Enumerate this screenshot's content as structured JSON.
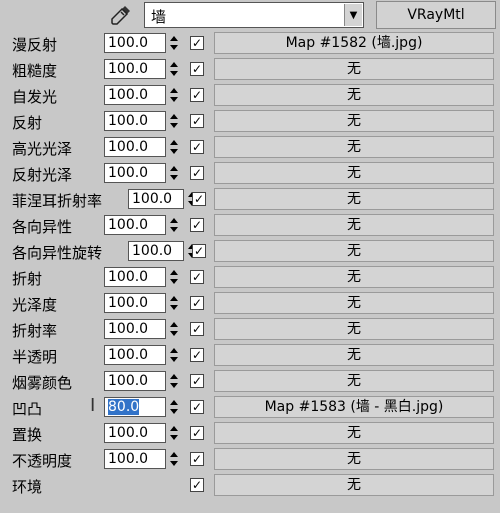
{
  "header": {
    "picker_icon": "eyedropper-icon",
    "material_name": "墙",
    "material_type": "VRayMtl",
    "dropdown_icon": "chevron-down-icon"
  },
  "rows": [
    {
      "label": "漫反射",
      "value": "100.0",
      "checked": true,
      "map": "Map #1582 (墙.jpg)"
    },
    {
      "label": "粗糙度",
      "value": "100.0",
      "checked": true,
      "map": "无"
    },
    {
      "label": "自发光",
      "value": "100.0",
      "checked": true,
      "map": "无"
    },
    {
      "label": "反射",
      "value": "100.0",
      "checked": true,
      "map": "无"
    },
    {
      "label": "高光光泽",
      "value": "100.0",
      "checked": true,
      "map": "无"
    },
    {
      "label": "反射光泽",
      "value": "100.0",
      "checked": true,
      "map": "无"
    },
    {
      "label": "菲涅耳折射率",
      "value": "100.0",
      "checked": true,
      "map": "无"
    },
    {
      "label": "各向异性",
      "value": "100.0",
      "checked": true,
      "map": "无"
    },
    {
      "label": "各向异性旋转",
      "value": "100.0",
      "checked": true,
      "map": "无"
    },
    {
      "label": "折射",
      "value": "100.0",
      "checked": true,
      "map": "无"
    },
    {
      "label": "光泽度",
      "value": "100.0",
      "checked": true,
      "map": "无"
    },
    {
      "label": "折射率",
      "value": "100.0",
      "checked": true,
      "map": "无"
    },
    {
      "label": "半透明",
      "value": "100.0",
      "checked": true,
      "map": "无"
    },
    {
      "label": "烟雾颜色",
      "value": "100.0",
      "checked": true,
      "map": "无"
    },
    {
      "label": "凹凸",
      "value": "80.0",
      "checked": true,
      "map": "Map #1583 (墙 - 黑白.jpg)"
    },
    {
      "label": "置换",
      "value": "100.0",
      "checked": true,
      "map": "无"
    },
    {
      "label": "不透明度",
      "value": "100.0",
      "checked": true,
      "map": "无"
    },
    {
      "label": "环境",
      "value": "",
      "checked": true,
      "map": "无"
    }
  ],
  "checkmark": "✓"
}
